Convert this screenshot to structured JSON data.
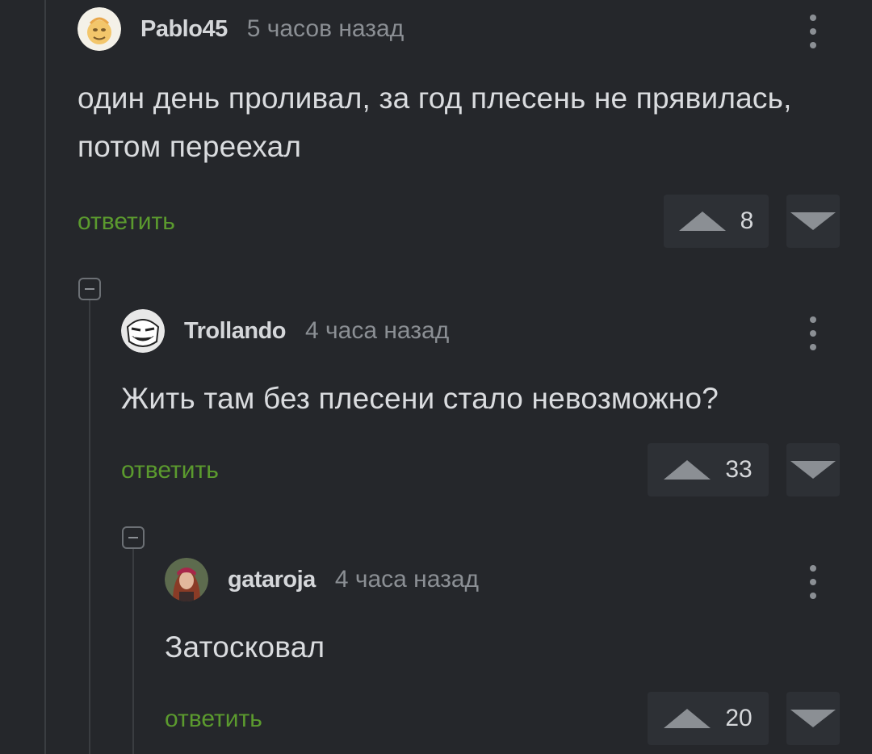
{
  "comments": [
    {
      "username": "Pablo45",
      "time": "5 часов назад",
      "text": "один день проливал, за год плесень не прявилась, потом переехал",
      "reply_label": "ответить",
      "rating": "8"
    },
    {
      "username": "Trollando",
      "time": "4 часа назад",
      "text": "Жить там без плесени стало невозможно?",
      "reply_label": "ответить",
      "rating": "33"
    },
    {
      "username": "gataroja",
      "time": "4 часа назад",
      "text": "Затосковал",
      "reply_label": "ответить",
      "rating": "20"
    }
  ],
  "colors": {
    "background": "#25272b",
    "reply_link": "#5b9a2e",
    "text": "#dadcdf",
    "muted": "#8b8f94"
  },
  "icons": [
    "more-vertical-icon",
    "upvote-arrow-icon",
    "downvote-arrow-icon",
    "collapse-thread-icon"
  ]
}
